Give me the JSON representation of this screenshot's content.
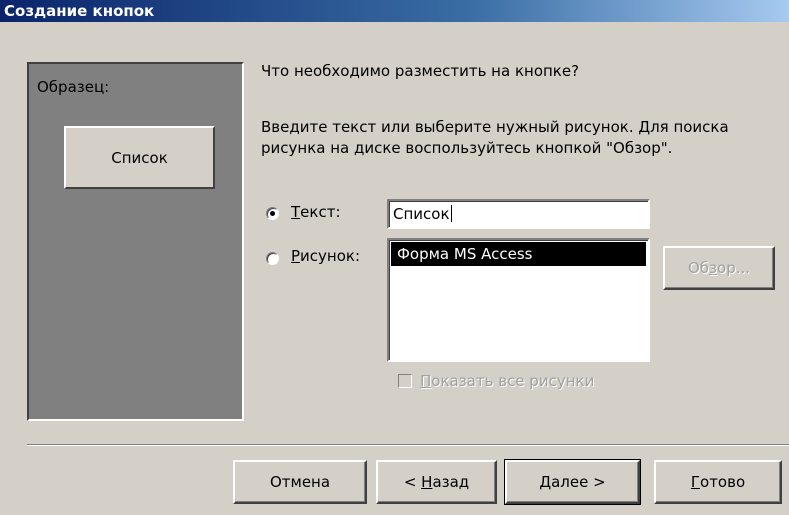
{
  "window": {
    "title": "Создание кнопок"
  },
  "sample": {
    "label": "Образец:",
    "button_caption": "Список"
  },
  "question": "Что необходимо разместить на кнопке?",
  "instruction_line1": "Введите текст или выберите нужный рисунок.  Для поиска",
  "instruction_line2": "рисунка на диске воспользуйтесь кнопкой \"Обзор\".",
  "options": {
    "text": {
      "label": "Текст:",
      "mnemonic": "Т",
      "rest": "екст:",
      "selected": true,
      "value": "Список"
    },
    "picture": {
      "label": "Рисунок:",
      "mnemonic": "Р",
      "rest": "исунок:",
      "selected": false
    }
  },
  "picture_list": {
    "items": [
      "Форма MS Access"
    ],
    "selected_index": 0
  },
  "browse_button": {
    "label": "Обзор...",
    "pre": "Об",
    "mnemonic": "з",
    "post": "ор...",
    "enabled": false
  },
  "show_all_checkbox": {
    "label": "Показать все рисунки",
    "mnemonic": "П",
    "rest": "оказать все рисунки",
    "checked": false,
    "enabled": false
  },
  "footer": {
    "cancel": "Отмена",
    "back": {
      "label": "< Назад",
      "pre": "< ",
      "mnemonic": "Н",
      "post": "азад"
    },
    "next": {
      "label": "Далее >",
      "mnemonic": "Д",
      "post": "алее >"
    },
    "finish": {
      "label": "Готово",
      "mnemonic": "Г",
      "post": "отово"
    }
  }
}
